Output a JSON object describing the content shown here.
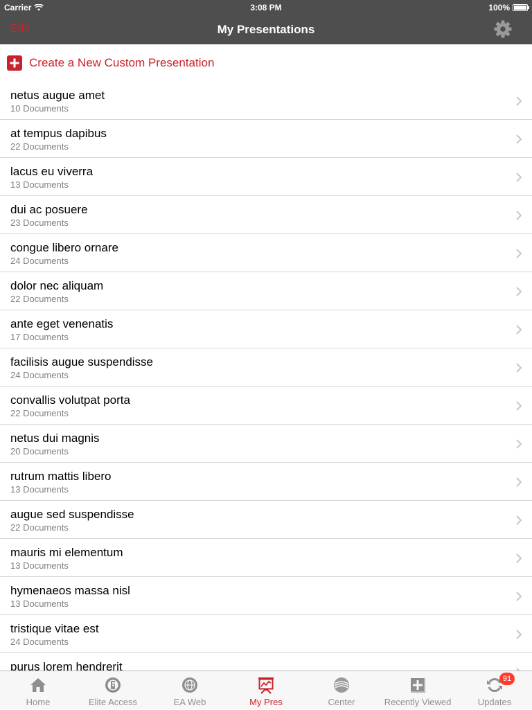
{
  "status_bar": {
    "carrier": "Carrier",
    "time": "3:08 PM",
    "battery": "100%",
    "battery_level": 1.0
  },
  "nav": {
    "title": "My Presentations",
    "edit_label": "Edit",
    "settings_icon": "gear-icon"
  },
  "create": {
    "label": "Create a New Custom Presentation",
    "icon": "plus-box-icon"
  },
  "presentations": [
    {
      "title": "netus augue amet",
      "subtitle": "10 Documents"
    },
    {
      "title": "at tempus dapibus",
      "subtitle": "22 Documents"
    },
    {
      "title": "lacus eu viverra",
      "subtitle": "13 Documents"
    },
    {
      "title": "dui ac posuere",
      "subtitle": "23 Documents"
    },
    {
      "title": "congue libero ornare",
      "subtitle": "24 Documents"
    },
    {
      "title": "dolor nec aliquam",
      "subtitle": "22 Documents"
    },
    {
      "title": "ante eget venenatis",
      "subtitle": "17 Documents"
    },
    {
      "title": "facilisis augue suspendisse",
      "subtitle": "24 Documents"
    },
    {
      "title": "convallis volutpat porta",
      "subtitle": "22 Documents"
    },
    {
      "title": "netus dui magnis",
      "subtitle": "20 Documents"
    },
    {
      "title": "rutrum mattis libero",
      "subtitle": "13 Documents"
    },
    {
      "title": "augue sed suspendisse",
      "subtitle": "22 Documents"
    },
    {
      "title": "mauris mi elementum",
      "subtitle": "13 Documents"
    },
    {
      "title": "hymenaeos massa nisl",
      "subtitle": "13 Documents"
    },
    {
      "title": "tristique vitae est",
      "subtitle": "24 Documents"
    },
    {
      "title": "purus lorem hendrerit",
      "subtitle": ""
    }
  ],
  "tabs": [
    {
      "label": "Home",
      "icon": "home-icon"
    },
    {
      "label": "Elite Access",
      "icon": "elite-access-icon"
    },
    {
      "label": "EA Web",
      "icon": "globe-icon"
    },
    {
      "label": "My Pres",
      "icon": "presentation-icon",
      "active": true
    },
    {
      "label": "Center",
      "icon": "center-icon"
    },
    {
      "label": "Recently Viewed",
      "icon": "recently-viewed-icon"
    },
    {
      "label": "Updates",
      "icon": "refresh-icon",
      "badge": "91"
    }
  ],
  "colors": {
    "accent": "#c8232c",
    "bar": "#4e4e4e",
    "badge": "#ff3b30"
  }
}
